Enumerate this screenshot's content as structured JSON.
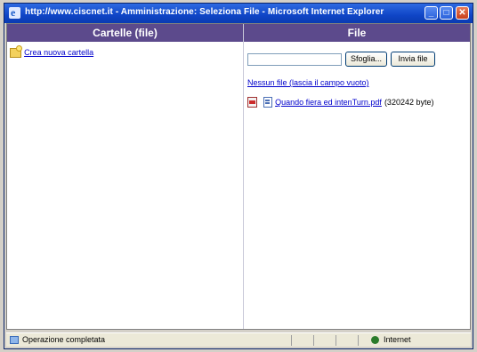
{
  "window": {
    "title": "http://www.ciscnet.it - Amministrazione: Seleziona File - Microsoft Internet Explorer"
  },
  "columns": {
    "folders_header": "Cartelle (file)",
    "files_header": "File"
  },
  "folders": {
    "new_folder_label": "Crea nuova cartella"
  },
  "upload": {
    "file_value": "",
    "browse_label": "Sfoglia...",
    "send_label": "Invia file"
  },
  "files": {
    "new_file_label": "Nessun file (lascia il campo vuoto)",
    "entries": [
      {
        "name": "Quando fiera ed intenTurn.pdf",
        "size": "(320242 byte)"
      }
    ]
  },
  "statusbar": {
    "status": "Operazione completata",
    "zone": "Internet"
  }
}
